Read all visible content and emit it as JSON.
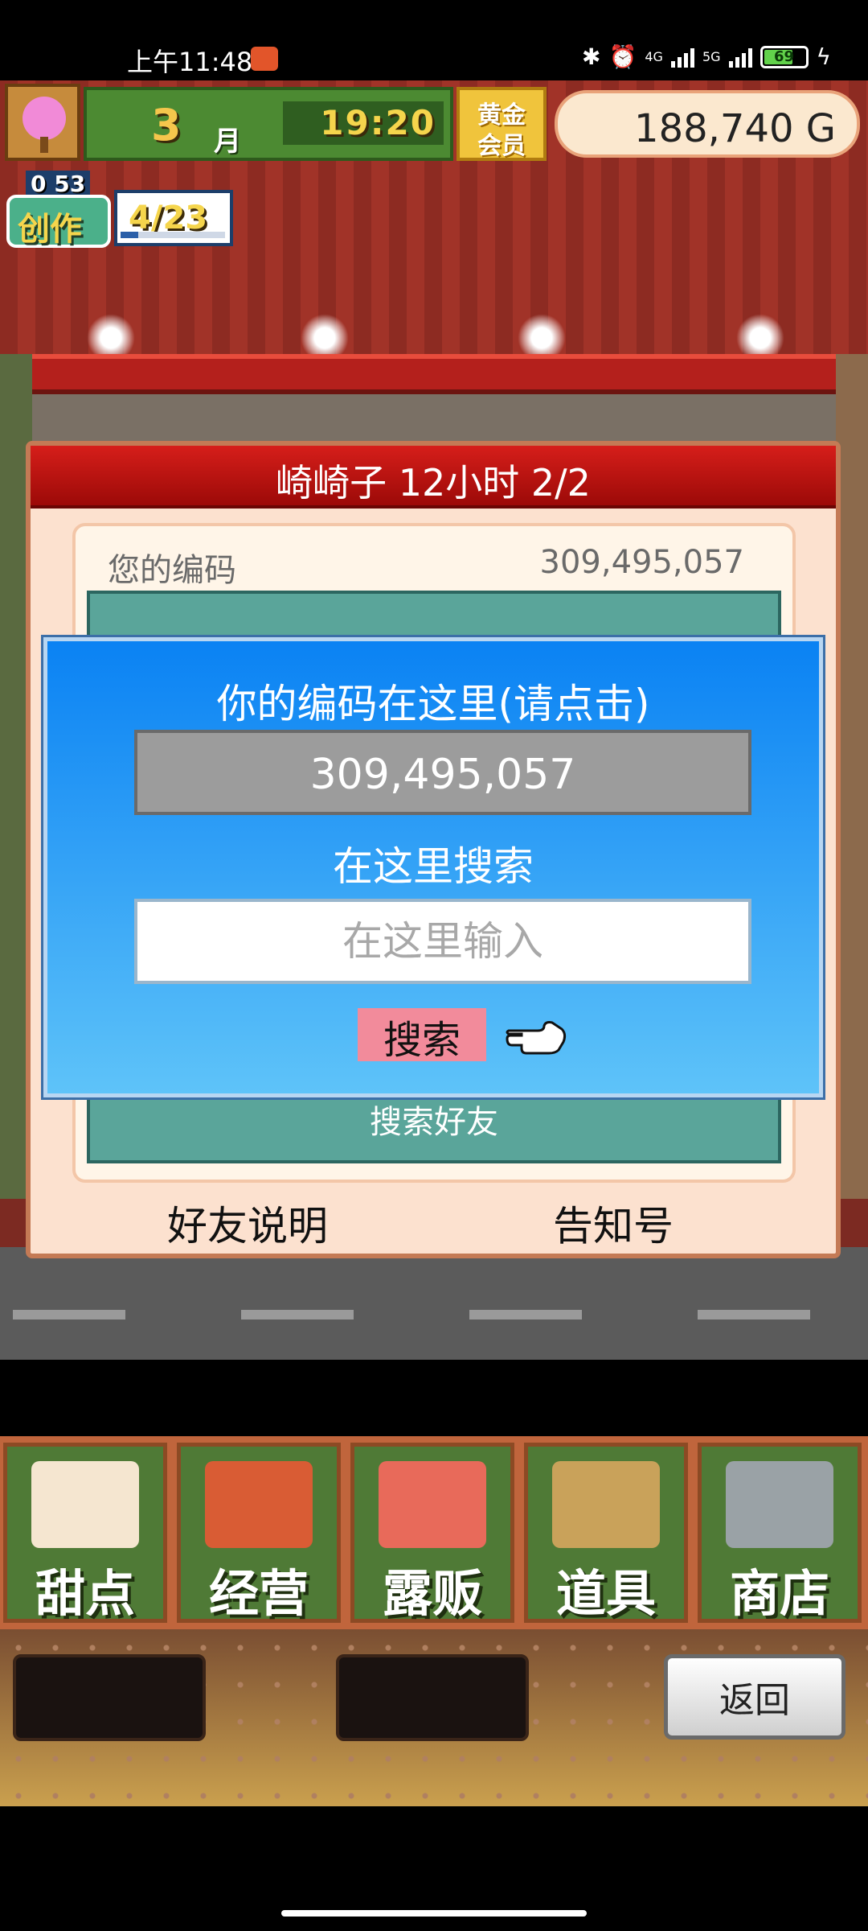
{
  "status_bar": {
    "time": "上午11:48",
    "network_1": "4G",
    "network_2": "5G",
    "battery": "69"
  },
  "hud": {
    "month_number": "3",
    "month_unit": "月",
    "clock": "19:20",
    "vip_line1": "黄金",
    "vip_line2": "会员",
    "money": "188,740 G",
    "create_counter": "0 53",
    "create_label": "创作",
    "create_count": "4/23",
    "create_progress": 0.17
  },
  "panel": {
    "title": "崎崎子  12小时 2/2",
    "code_label": "您的编码",
    "code_value": "309,495,057",
    "teal_peek_text": "搜索好友",
    "teal_bottom_text": "搜索好友",
    "footer_left": "好友说明",
    "footer_right": "告知号"
  },
  "dialog": {
    "title": "你的编码在这里(请点击)",
    "code": "309,495,057",
    "search_label": "在这里搜索",
    "search_placeholder": "在这里输入",
    "search_value": "",
    "search_button": "搜索",
    "pointer_icon": "pointing-hand-icon"
  },
  "bottom_menu": {
    "items": [
      {
        "label": "甜点",
        "icon": "cake-icon"
      },
      {
        "label": "经营",
        "icon": "shop-icon"
      },
      {
        "label": "露贩",
        "icon": "food-truck-icon"
      },
      {
        "label": "道具",
        "icon": "gear-bag-icon"
      },
      {
        "label": "商店",
        "icon": "cart-icon"
      }
    ],
    "back_button": "返回"
  }
}
